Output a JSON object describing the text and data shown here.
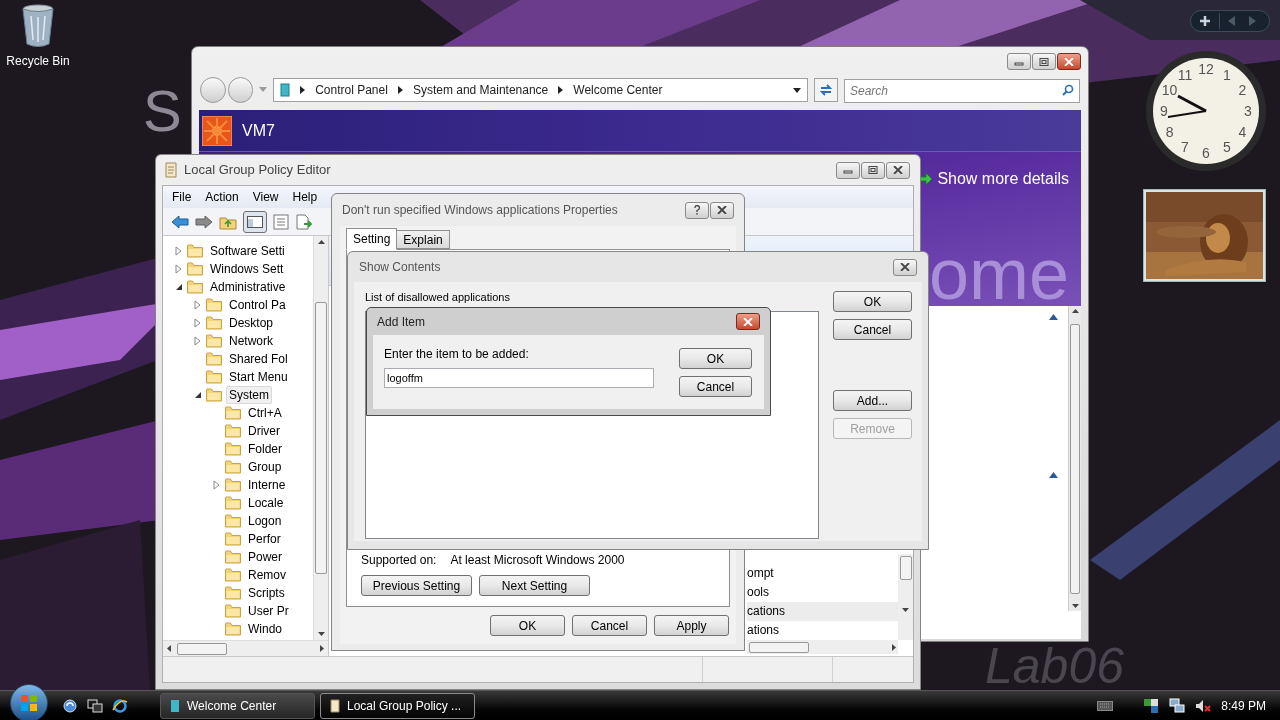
{
  "desktop": {
    "icons": [
      {
        "label": "Recycle Bin"
      }
    ],
    "left_letter": "S",
    "corner_text": "Lab06"
  },
  "gadgets": {
    "clock": {
      "numerals": [
        "12",
        "11",
        "1",
        "10",
        "2",
        "9",
        "3",
        "8",
        "4",
        "7",
        "5",
        "6"
      ]
    }
  },
  "welcome_window": {
    "breadcrumb": [
      "Control Panel",
      "System and Maintenance",
      "Welcome Center"
    ],
    "search": {
      "placeholder": "Search"
    },
    "computer_name": "VM7",
    "details_link": "Show more details",
    "heading": "ome"
  },
  "gpe_window": {
    "title": "Local Group Policy Editor",
    "menu": [
      "File",
      "Action",
      "View",
      "Help"
    ],
    "tree": [
      {
        "label": "Software Setti",
        "has_arrow": true,
        "expanded": false,
        "selected": false
      },
      {
        "label": "Windows Sett",
        "has_arrow": true,
        "expanded": false,
        "selected": false
      },
      {
        "label": "Administrative",
        "has_arrow": true,
        "expanded": true,
        "selected": false,
        "children": [
          {
            "label": "Control Pa",
            "has_arrow": true,
            "expanded": false,
            "selected": false
          },
          {
            "label": "Desktop",
            "has_arrow": true,
            "expanded": false,
            "selected": false
          },
          {
            "label": "Network",
            "has_arrow": true,
            "expanded": false,
            "selected": false
          },
          {
            "label": "Shared Fol",
            "has_arrow": false,
            "expanded": false,
            "selected": false
          },
          {
            "label": "Start Menu",
            "has_arrow": false,
            "expanded": false,
            "selected": false
          },
          {
            "label": "System",
            "has_arrow": true,
            "expanded": true,
            "selected": true,
            "children": [
              {
                "label": "Ctrl+A",
                "has_arrow": false,
                "expanded": false,
                "selected": false
              },
              {
                "label": "Driver",
                "has_arrow": false,
                "expanded": false,
                "selected": false
              },
              {
                "label": "Folder",
                "has_arrow": false,
                "expanded": false,
                "selected": false
              },
              {
                "label": "Group",
                "has_arrow": false,
                "expanded": false,
                "selected": false
              },
              {
                "label": "Interne",
                "has_arrow": true,
                "expanded": false,
                "selected": false
              },
              {
                "label": "Locale",
                "has_arrow": false,
                "expanded": false,
                "selected": false
              },
              {
                "label": "Logon",
                "has_arrow": false,
                "expanded": false,
                "selected": false
              },
              {
                "label": "Perfor",
                "has_arrow": false,
                "expanded": false,
                "selected": false
              },
              {
                "label": "Power",
                "has_arrow": false,
                "expanded": false,
                "selected": false
              },
              {
                "label": "Remov",
                "has_arrow": false,
                "expanded": false,
                "selected": false
              },
              {
                "label": "Scripts",
                "has_arrow": false,
                "expanded": false,
                "selected": false
              },
              {
                "label": "User Pr",
                "has_arrow": false,
                "expanded": false,
                "selected": false
              },
              {
                "label": "Windo",
                "has_arrow": false,
                "expanded": false,
                "selected": false
              }
            ]
          }
        ]
      }
    ],
    "list_rows": [
      {
        "text": "ompt",
        "selected": false
      },
      {
        "text": "ools",
        "selected": false
      },
      {
        "text": "cations",
        "selected": true
      },
      {
        "text": "ations",
        "selected": false
      }
    ]
  },
  "properties_dialog": {
    "title": "Don't run specified Windows applications Properties",
    "tabs": [
      {
        "label": "Setting",
        "selected": true
      },
      {
        "label": "Explain",
        "selected": false
      }
    ],
    "supported_label": "Supported on:",
    "supported_value": "At least Microsoft Windows 2000",
    "nav_buttons": [
      "Previous Setting",
      "Next Setting"
    ],
    "buttons": [
      "OK",
      "Cancel",
      "Apply"
    ]
  },
  "show_contents": {
    "title": "Show Contents",
    "list_label": "List of disallowed applications",
    "buttons": [
      {
        "label": "OK",
        "disabled": false
      },
      {
        "label": "Cancel",
        "disabled": false
      }
    ],
    "edit_buttons": [
      {
        "label": "Add...",
        "disabled": false
      },
      {
        "label": "Remove",
        "disabled": true
      }
    ]
  },
  "add_item": {
    "title": "Add Item",
    "prompt": "Enter the item to be added:",
    "value": "logoffm",
    "buttons": [
      "OK",
      "Cancel"
    ]
  },
  "taskbar": {
    "windows": [
      {
        "label": "Welcome Center",
        "selected": false
      },
      {
        "label": "Local Group Policy ...",
        "selected": true
      }
    ],
    "time": "8:49 PM"
  }
}
